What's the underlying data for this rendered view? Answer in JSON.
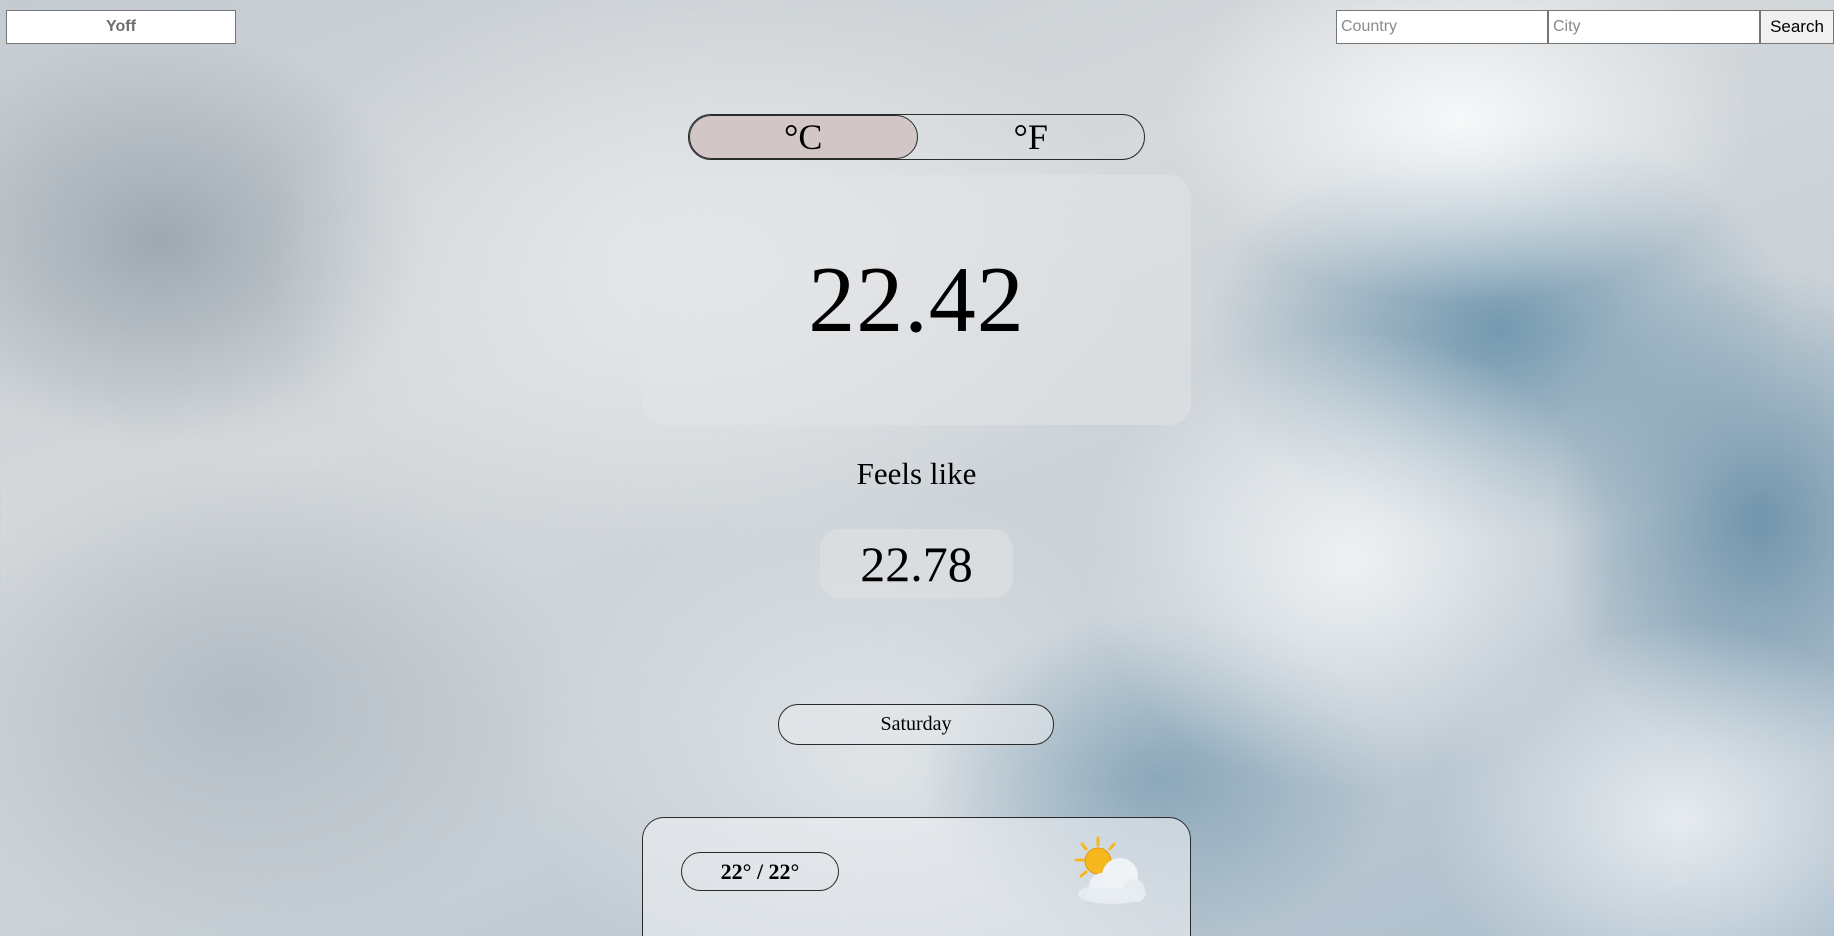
{
  "header": {
    "location": "Yoff",
    "country_placeholder": "Country",
    "city_placeholder": "City",
    "search_label": "Search"
  },
  "units": {
    "celsius": "°C",
    "fahrenheit": "°F",
    "selected": "celsius"
  },
  "current": {
    "temperature": "22.42",
    "feels_like_label": "Feels like",
    "feels_like": "22.78"
  },
  "forecast": {
    "day": "Saturday",
    "min_max": "22° / 22°",
    "icon": "sun-behind-cloud-icon"
  },
  "colors": {
    "active_unit_bg": "#d3c6c6",
    "sun": "#f6b61e",
    "cloud": "#e9eef3"
  }
}
